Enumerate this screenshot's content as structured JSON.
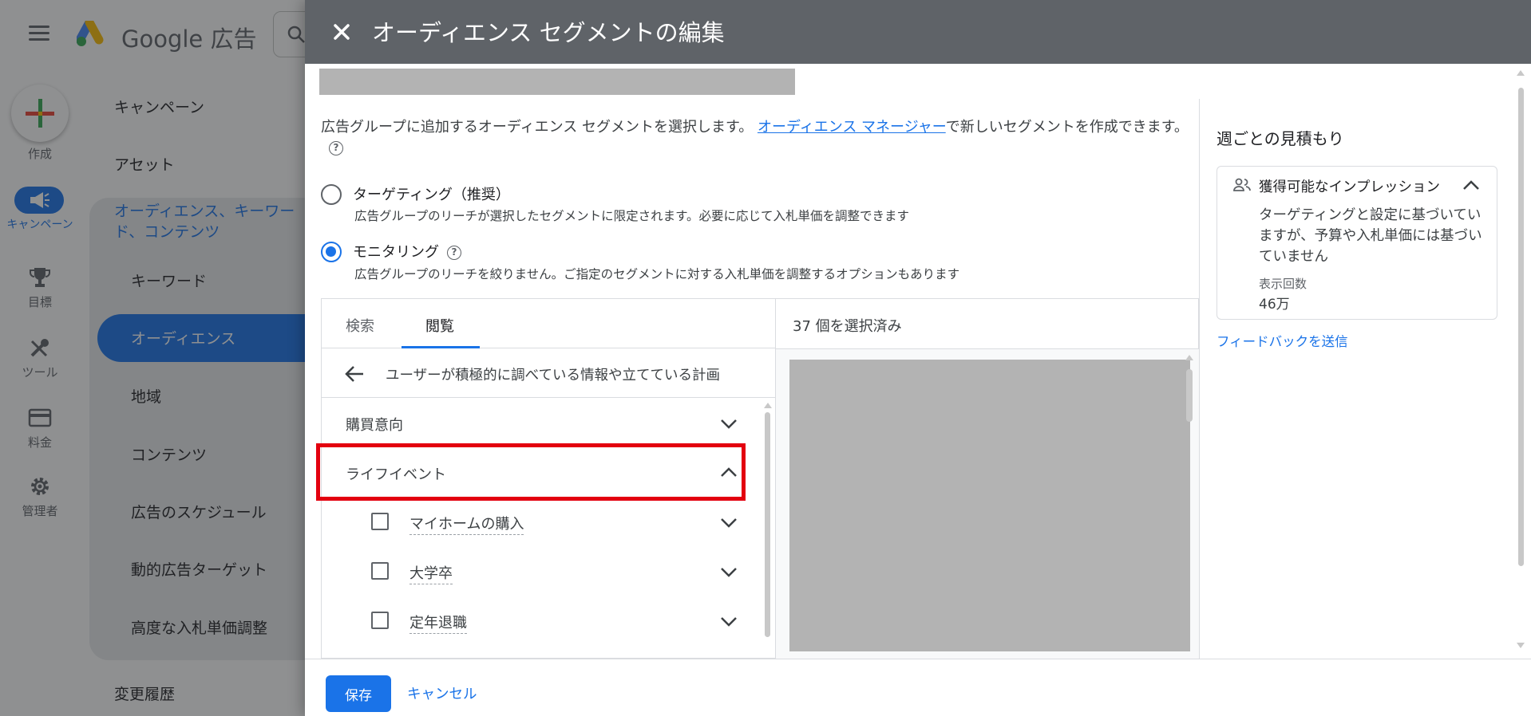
{
  "app": {
    "logo_text": "Google 広告",
    "create_label": "作成",
    "rail": [
      {
        "label": "キャンペーン",
        "icon": "megaphone-icon"
      },
      {
        "label": "目標",
        "icon": "trophy-icon"
      },
      {
        "label": "ツール",
        "icon": "tools-icon"
      },
      {
        "label": "料金",
        "icon": "credit-card-icon"
      },
      {
        "label": "管理者",
        "icon": "gear-icon"
      }
    ],
    "subnav": {
      "campaigns": "キャンペーン",
      "assets": "アセット",
      "group_title": "オーディエンス、キーワード、コンテンツ",
      "items": [
        "キーワード",
        "オーディエンス",
        "地域",
        "コンテンツ",
        "広告のスケジュール",
        "動的広告ターゲット",
        "高度な入札単価調整"
      ],
      "change_history": "変更履歴"
    }
  },
  "dialog": {
    "title": "オーディエンス セグメントの編集",
    "description_prefix": "広告グループに追加するオーディエンス セグメントを選択します。 ",
    "description_link": "オーディエンス マネージャー",
    "description_suffix": "で新しいセグメントを作成できます。",
    "targeting": {
      "title": "ターゲティング（推奨）",
      "subtitle": "広告グループのリーチが選択したセグメントに限定されます。必要に応じて入札単価を調整できます"
    },
    "monitoring": {
      "title": "モニタリング",
      "subtitle": "広告グループのリーチを絞りません。ご指定のセグメントに対する入札単価を調整するオプションもあります"
    },
    "tabs": [
      "検索",
      "閲覧"
    ],
    "selected_count": "37 個を選択済み",
    "back_label": "ユーザーが積極的に調べている情報や立てている計画",
    "categories": [
      {
        "label": "購買意向",
        "expanded": false
      },
      {
        "label": "ライフイベント",
        "expanded": true
      }
    ],
    "life_events": [
      "マイホームの購入",
      "大学卒",
      "定年退職"
    ],
    "estimate": {
      "title": "週ごとの見積もり",
      "card_title": "獲得可能なインプレッション",
      "card_desc": "ターゲティングと設定に基づいていますが、予算や入札単価には基づいていません",
      "metric_label": "表示回数",
      "metric_value": "46万"
    },
    "feedback": "フィードバックを送信",
    "save": "保存",
    "cancel": "キャンセル"
  },
  "colors": {
    "accent": "#1a73e8",
    "highlight": "#e3000f",
    "header": "#5f6368"
  }
}
